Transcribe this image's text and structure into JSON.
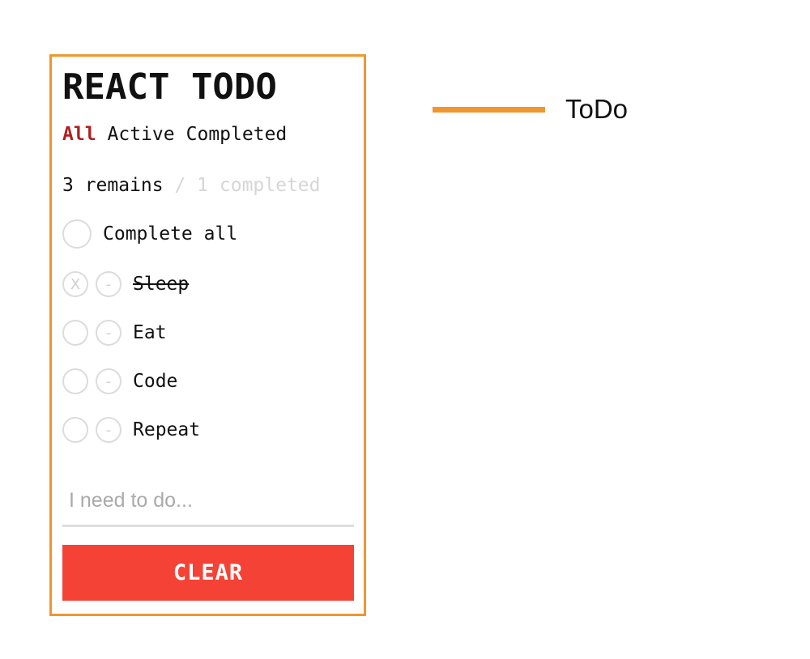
{
  "app": {
    "title": "REACT TODO",
    "filters": [
      {
        "label": "All",
        "active": true
      },
      {
        "label": "Active",
        "active": false
      },
      {
        "label": "Completed",
        "active": false
      }
    ],
    "counts": {
      "remains": "3 remains",
      "completed": "/ 1 completed"
    },
    "complete_all_label": "Complete all",
    "todos": [
      {
        "label": "Sleep",
        "done": true,
        "toggle_glyph": "X",
        "remove_glyph": "-"
      },
      {
        "label": "Eat",
        "done": false,
        "toggle_glyph": "",
        "remove_glyph": "-"
      },
      {
        "label": "Code",
        "done": false,
        "toggle_glyph": "",
        "remove_glyph": "-"
      },
      {
        "label": "Repeat",
        "done": false,
        "toggle_glyph": "",
        "remove_glyph": "-"
      }
    ],
    "input": {
      "value": "",
      "placeholder": "I need to do..."
    },
    "clear_label": "CLEAR"
  },
  "legend": {
    "label": "ToDo"
  },
  "colors": {
    "border_accent": "#f0962e",
    "active_filter": "#b21f1f",
    "clear_button": "#f44336",
    "muted_text": "#d6d6d6"
  }
}
